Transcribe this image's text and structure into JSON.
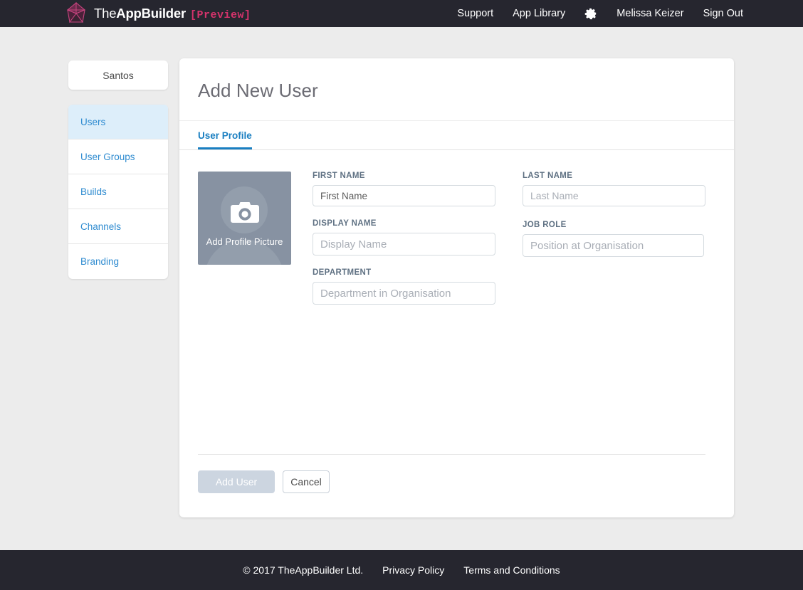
{
  "header": {
    "brand_prefix": "The",
    "brand_main": "AppBuilder",
    "brand_tag": "[Preview]",
    "logo_icon": "gem-polygon-logo",
    "nav": [
      {
        "label": "Support",
        "name": "support"
      },
      {
        "label": "App Library",
        "name": "app-library"
      }
    ],
    "settings_icon": "gear-icon",
    "user_name": "Melissa Keizer",
    "sign_out": "Sign Out",
    "bar_color": "#26262f",
    "accent_color": "#d6336c"
  },
  "sidebar": {
    "organisation": "Santos",
    "items": [
      {
        "label": "Users",
        "active": true
      },
      {
        "label": "User Groups",
        "active": false
      },
      {
        "label": "Builds",
        "active": false
      },
      {
        "label": "Channels",
        "active": false
      },
      {
        "label": "Branding",
        "active": false
      }
    ],
    "active_bg": "#ddeefa",
    "link_color": "#2e8bd0"
  },
  "main": {
    "title": "Add New User",
    "tabs": [
      {
        "label": "User Profile",
        "active": true
      }
    ],
    "tab_color": "#1a7fc1",
    "avatar": {
      "label": "Add Profile Picture",
      "icon": "camera-icon",
      "bg_color": "#8792a2"
    },
    "fields": {
      "first_name": {
        "label": "FIRST NAME",
        "value": "First Name",
        "placeholder": "First Name"
      },
      "last_name": {
        "label": "LAST NAME",
        "value": "",
        "placeholder": "Last Name"
      },
      "display_name": {
        "label": "DISPLAY NAME",
        "value": "",
        "placeholder": "Display Name"
      },
      "job_role": {
        "label": "JOB ROLE",
        "value": "",
        "placeholder": "Position at Organisation"
      },
      "department": {
        "label": "DEPARTMENT",
        "value": "",
        "placeholder": "Department in Organisation"
      }
    },
    "actions": {
      "submit_label": "Add User",
      "submit_disabled": true,
      "cancel_label": "Cancel"
    }
  },
  "footer": {
    "copyright": "© 2017 TheAppBuilder Ltd.",
    "links": [
      {
        "label": "Privacy Policy"
      },
      {
        "label": "Terms and Conditions"
      }
    ]
  }
}
